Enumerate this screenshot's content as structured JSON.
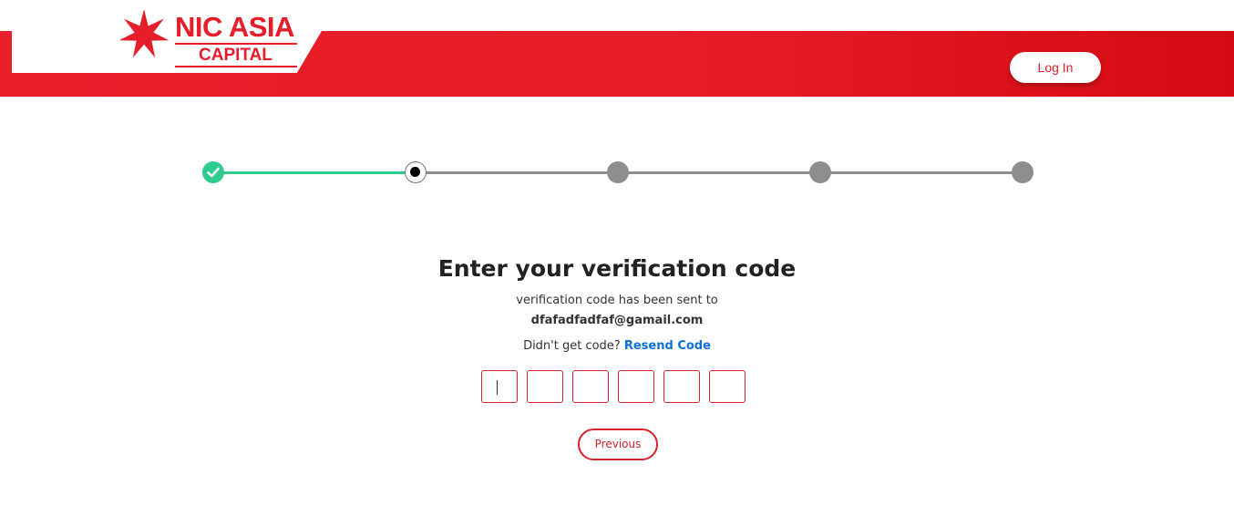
{
  "brand": {
    "name_line1": "NIC ASIA",
    "name_line2": "CAPITAL",
    "primary_color": "#e61e2a"
  },
  "header": {
    "login_label": "Log In"
  },
  "stepper": {
    "steps": [
      {
        "state": "completed",
        "icon": "check-icon"
      },
      {
        "state": "current"
      },
      {
        "state": "pending"
      },
      {
        "state": "pending"
      },
      {
        "state": "pending"
      }
    ],
    "completed_color": "#2ecc8f",
    "pending_color": "#8e8e8e"
  },
  "verification": {
    "title": "Enter your verification code",
    "subtitle": "verification code has been sent to",
    "email": "dfafadfadfaf@gamail.com",
    "resend_prompt": "Didn't get code?",
    "resend_label": "Resend Code",
    "link_color": "#0b72d8",
    "code_length": 6,
    "code_digits": [
      "",
      "",
      "",
      "",
      "",
      ""
    ]
  },
  "actions": {
    "previous_label": "Previous"
  }
}
